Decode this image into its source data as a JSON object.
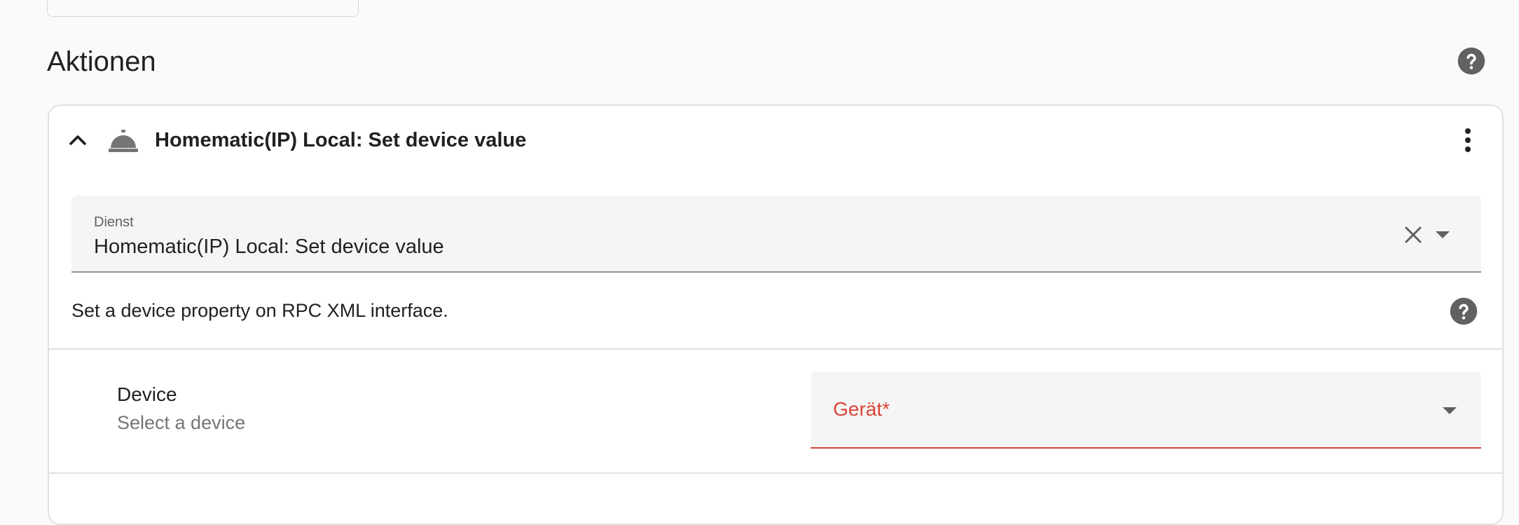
{
  "section": {
    "title": "Aktionen",
    "help_icon": "help-circle-icon"
  },
  "action": {
    "title": "Homematic(IP) Local: Set device value",
    "collapse_icon": "chevron-up-icon",
    "service_icon": "room-service-icon",
    "menu_icon": "dots-vertical-icon",
    "service_field": {
      "label": "Dienst",
      "value": "Homematic(IP) Local: Set device value",
      "clear_icon": "close-icon",
      "dropdown_icon": "menu-down-icon"
    },
    "description": "Set a device property on RPC XML interface.",
    "description_help_icon": "help-circle-icon",
    "fields": [
      {
        "name": "Device",
        "description": "Select a device",
        "input_label": "Gerät*",
        "dropdown_icon": "menu-down-icon"
      }
    ]
  },
  "colors": {
    "background": "#fafafa",
    "card": "#ffffff",
    "border": "#e0e0e0",
    "error": "#db4437",
    "field_bg": "#f5f5f5",
    "icon": "#616161"
  }
}
